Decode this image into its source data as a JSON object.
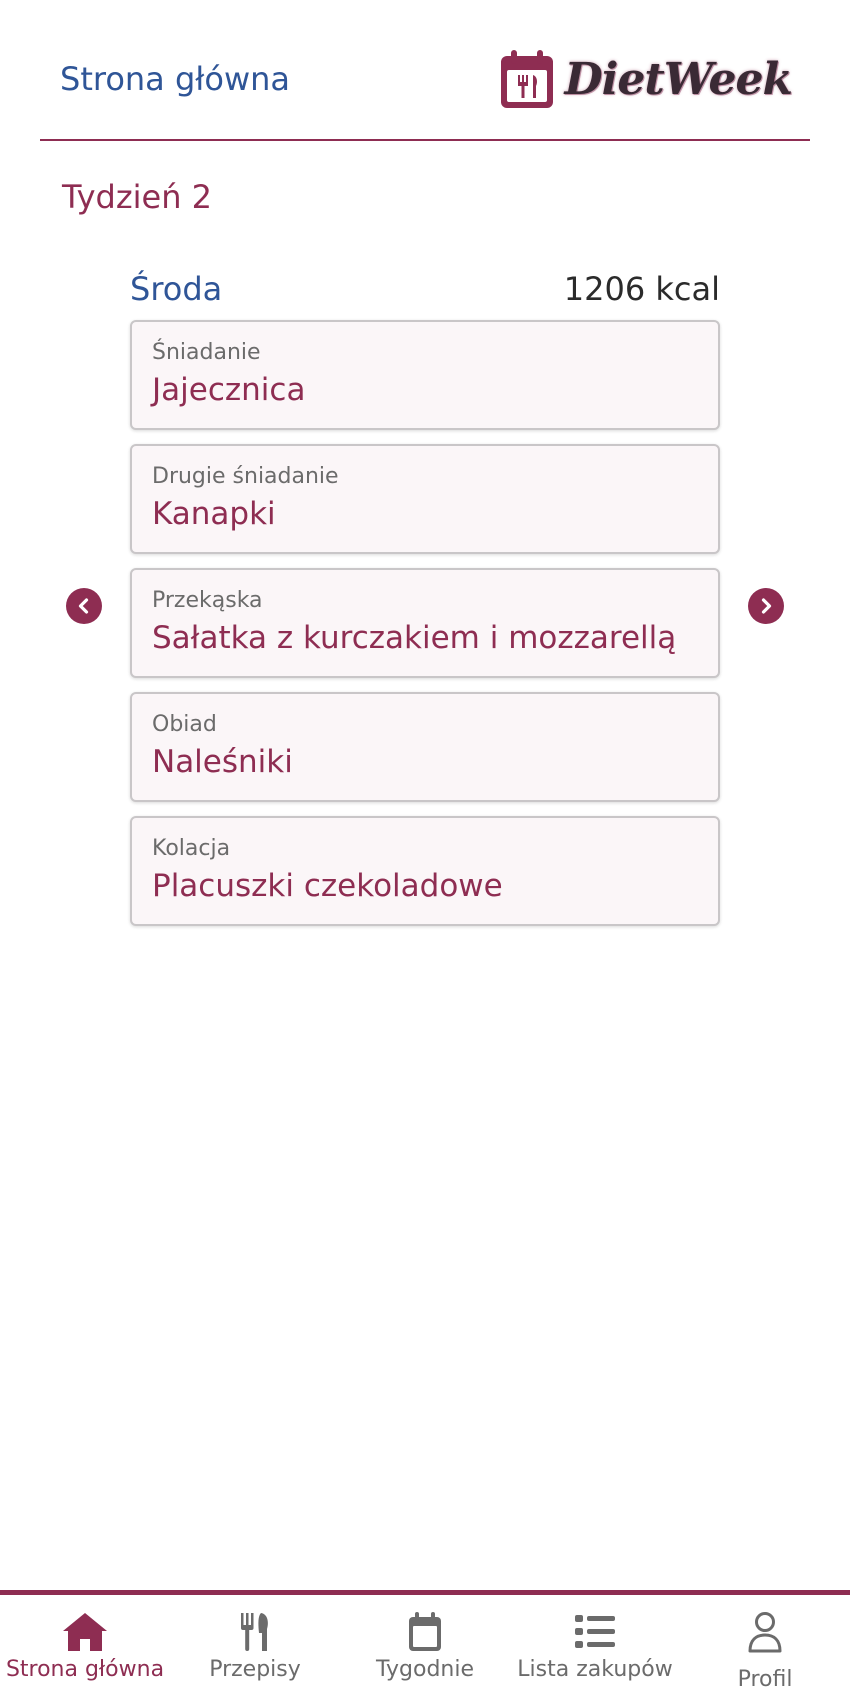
{
  "header": {
    "title": "Strona główna",
    "app_name": "DietWeek"
  },
  "week": {
    "title": "Tydzień 2"
  },
  "day": {
    "name": "Środa",
    "kcal": "1206 kcal"
  },
  "meals": [
    {
      "label": "Śniadanie",
      "name": "Jajecznica"
    },
    {
      "label": "Drugie śniadanie",
      "name": "Kanapki"
    },
    {
      "label": "Przekąska",
      "name": "Sałatka z kurczakiem i mozzarellą"
    },
    {
      "label": "Obiad",
      "name": "Naleśniki"
    },
    {
      "label": "Kolacja",
      "name": "Placuszki czekoladowe"
    }
  ],
  "nav": {
    "items": [
      {
        "label": "Strona główna",
        "icon": "home-icon",
        "active": true
      },
      {
        "label": "Przepisy",
        "icon": "utensils-icon",
        "active": false
      },
      {
        "label": "Tygodnie",
        "icon": "calendar-icon",
        "active": false
      },
      {
        "label": "Lista zakupów",
        "icon": "list-icon",
        "active": false
      },
      {
        "label": "Profil",
        "icon": "user-icon",
        "active": false
      }
    ]
  },
  "colors": {
    "accent": "#8e2d52",
    "title_blue": "#2f5597",
    "muted": "#6b6b6b"
  }
}
